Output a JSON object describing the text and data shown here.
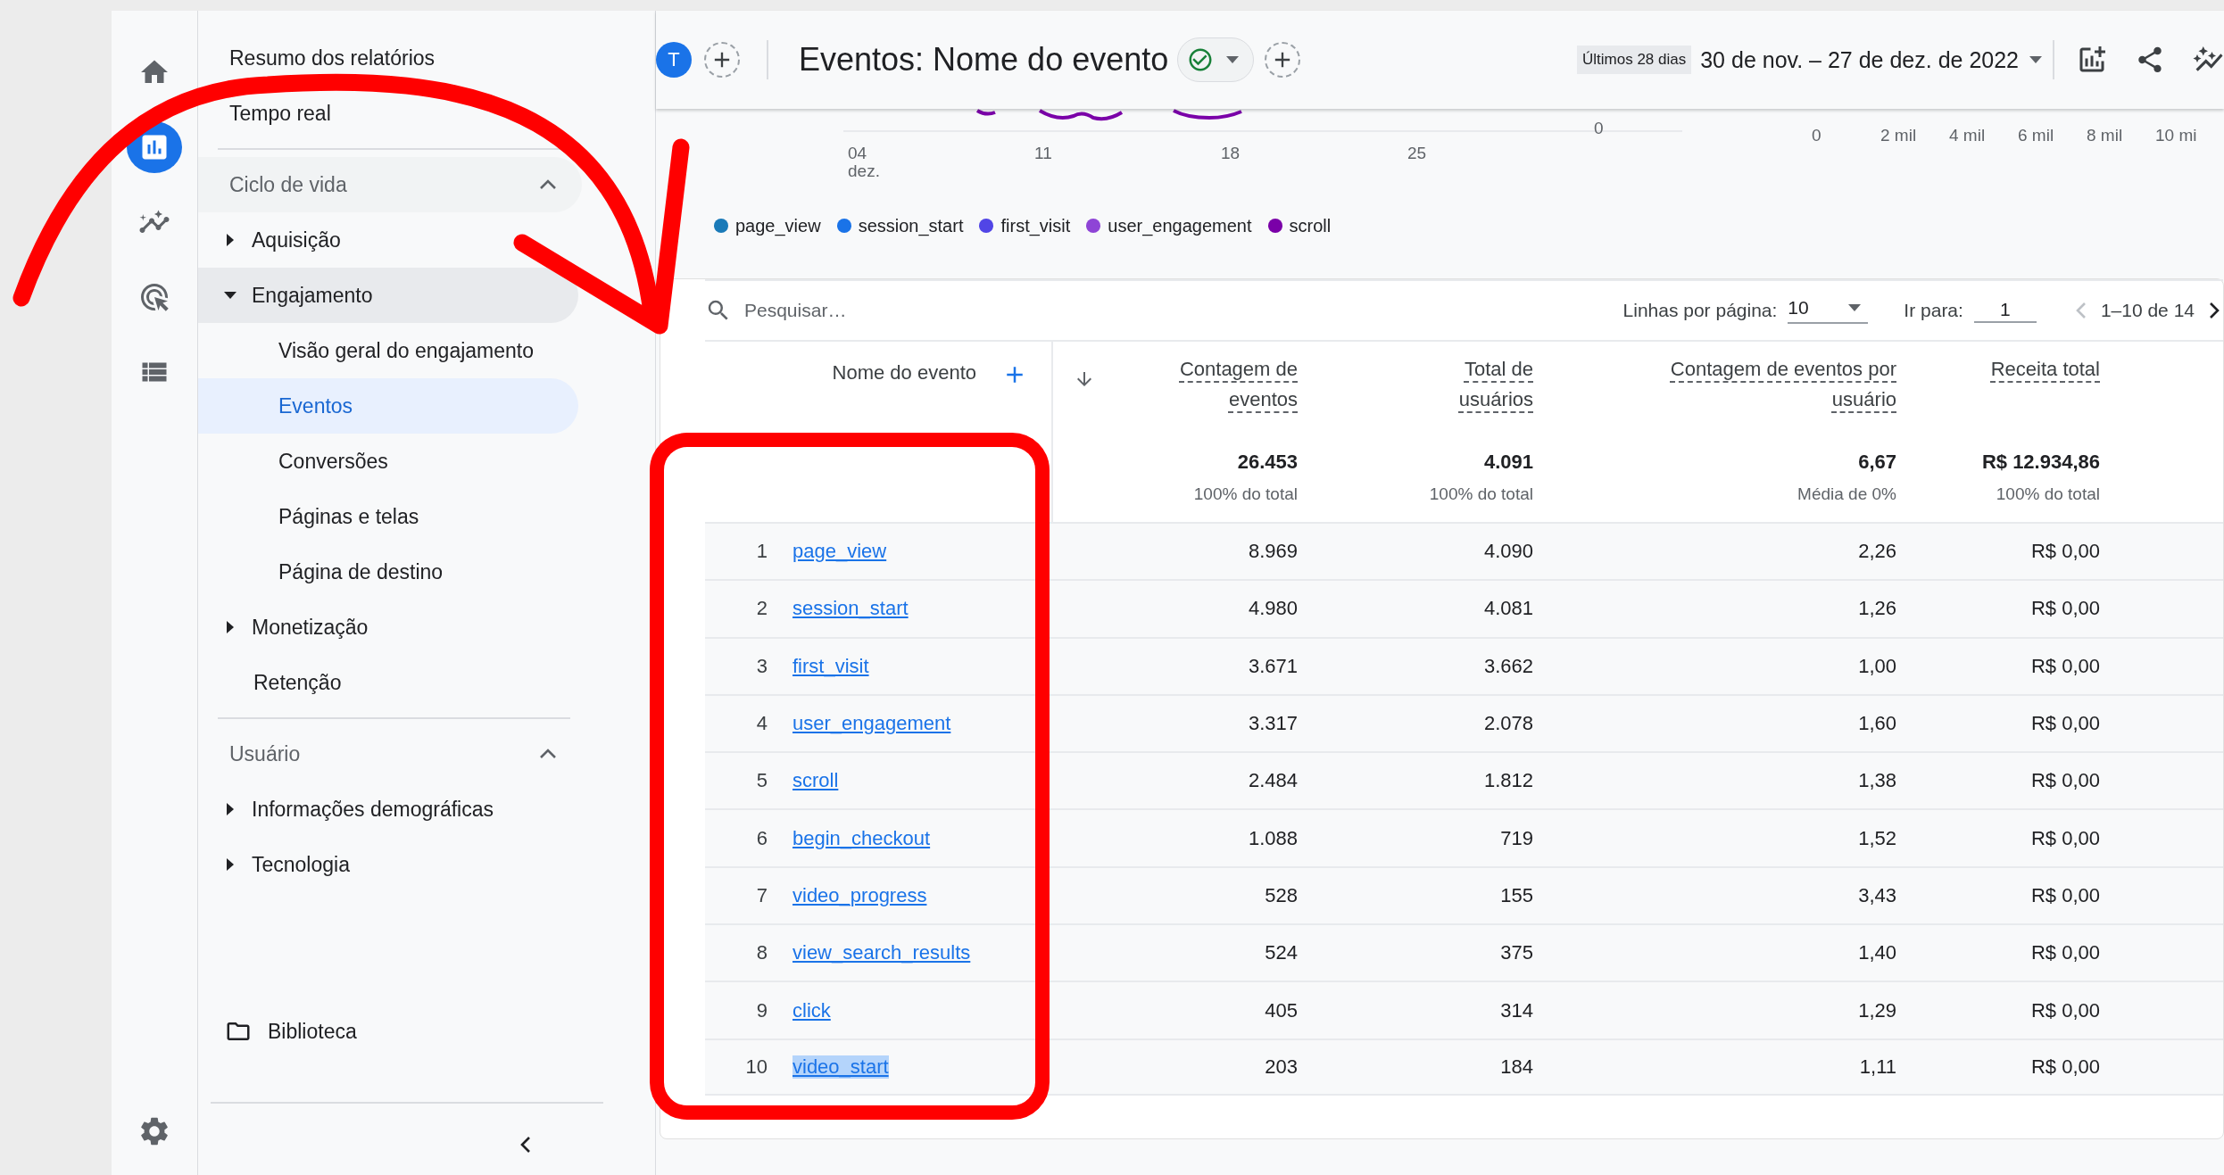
{
  "rail": {
    "items": [
      {
        "kind": "home",
        "selected": false
      },
      {
        "kind": "reports",
        "selected": true
      },
      {
        "kind": "explore",
        "selected": false
      },
      {
        "kind": "advertising",
        "selected": false
      },
      {
        "kind": "configure",
        "selected": false
      }
    ]
  },
  "nav": {
    "links": [
      {
        "label": "Resumo dos relatórios"
      },
      {
        "label": "Tempo real"
      }
    ],
    "sections": [
      {
        "title": "Ciclo de vida",
        "expanded": true,
        "items": [
          {
            "kind": "group",
            "label": "Aquisição",
            "expanded": false
          },
          {
            "kind": "group",
            "label": "Engajamento",
            "expanded": true,
            "children": [
              {
                "label": "Visão geral do engajamento",
                "selected": false
              },
              {
                "label": "Eventos",
                "selected": true
              },
              {
                "label": "Conversões",
                "selected": false
              },
              {
                "label": "Páginas e telas",
                "selected": false
              },
              {
                "label": "Página de destino",
                "selected": false
              }
            ]
          },
          {
            "kind": "group",
            "label": "Monetização",
            "expanded": false
          },
          {
            "kind": "link",
            "label": "Retenção"
          }
        ]
      },
      {
        "title": "Usuário",
        "expanded": true,
        "items": [
          {
            "kind": "group",
            "label": "Informações demográficas",
            "expanded": false
          },
          {
            "kind": "group",
            "label": "Tecnologia",
            "expanded": false
          }
        ]
      }
    ],
    "library": "Biblioteca"
  },
  "header": {
    "avatar": "T",
    "title": "Eventos: Nome do evento",
    "date_preset": "Últimos 28 dias",
    "date_range": "30 de nov. – 27 de dez. de 2022"
  },
  "charts": {
    "line_x_ticks": [
      {
        "label": "04",
        "sublabel": "dez."
      },
      {
        "label": "11"
      },
      {
        "label": "18"
      },
      {
        "label": "25"
      }
    ],
    "line_y_tick": "0",
    "bar_x_ticks": [
      "0",
      "2 mil",
      "4 mil",
      "6 mil",
      "8 mil",
      "10 mi"
    ]
  },
  "legend": [
    {
      "label": "page_view",
      "color": "#1a7ab8"
    },
    {
      "label": "session_start",
      "color": "#1a73e8"
    },
    {
      "label": "first_visit",
      "color": "#5145e6"
    },
    {
      "label": "user_engagement",
      "color": "#8e44d6"
    },
    {
      "label": "scroll",
      "color": "#7a00a8"
    }
  ],
  "table": {
    "search_placeholder": "Pesquisar…",
    "rows_per_page_label": "Linhas por página:",
    "rows_per_page": "10",
    "goto_label": "Ir para:",
    "goto_value": "1",
    "page_range": "1–10 de 14",
    "dimension": "Nome do evento",
    "metrics": [
      "Contagem de eventos",
      "Total de usuários",
      "Contagem de eventos por usuário",
      "Receita total"
    ],
    "totals": [
      {
        "value": "26.453",
        "note": "100% do total"
      },
      {
        "value": "4.091",
        "note": "100% do total"
      },
      {
        "value": "6,67",
        "note": "Média de 0%"
      },
      {
        "value": "R$ 12.934,86",
        "note": "100% do total"
      }
    ],
    "rows": [
      {
        "index": "1",
        "name": "page_view",
        "highlighted": false,
        "values": [
          "8.969",
          "4.090",
          "2,26",
          "R$ 0,00"
        ]
      },
      {
        "index": "2",
        "name": "session_start",
        "highlighted": false,
        "values": [
          "4.980",
          "4.081",
          "1,26",
          "R$ 0,00"
        ]
      },
      {
        "index": "3",
        "name": "first_visit",
        "highlighted": false,
        "values": [
          "3.671",
          "3.662",
          "1,00",
          "R$ 0,00"
        ]
      },
      {
        "index": "4",
        "name": "user_engagement",
        "highlighted": false,
        "values": [
          "3.317",
          "2.078",
          "1,60",
          "R$ 0,00"
        ]
      },
      {
        "index": "5",
        "name": "scroll",
        "highlighted": false,
        "values": [
          "2.484",
          "1.812",
          "1,38",
          "R$ 0,00"
        ]
      },
      {
        "index": "6",
        "name": "begin_checkout",
        "highlighted": false,
        "values": [
          "1.088",
          "719",
          "1,52",
          "R$ 0,00"
        ]
      },
      {
        "index": "7",
        "name": "video_progress",
        "highlighted": false,
        "values": [
          "528",
          "155",
          "3,43",
          "R$ 0,00"
        ]
      },
      {
        "index": "8",
        "name": "view_search_results",
        "highlighted": false,
        "values": [
          "524",
          "375",
          "1,40",
          "R$ 0,00"
        ]
      },
      {
        "index": "9",
        "name": "click",
        "highlighted": false,
        "values": [
          "405",
          "314",
          "1,29",
          "R$ 0,00"
        ]
      },
      {
        "index": "10",
        "name": "video_start",
        "highlighted": true,
        "values": [
          "203",
          "184",
          "1,11",
          "R$ 0,00"
        ]
      }
    ]
  }
}
